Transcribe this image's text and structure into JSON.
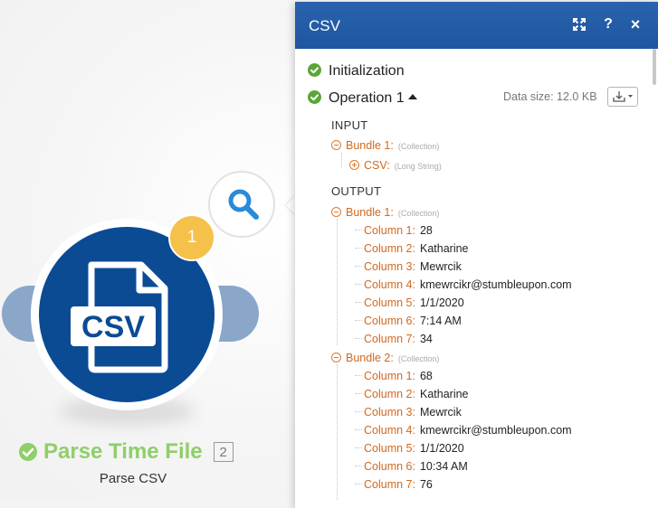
{
  "module": {
    "name": "Parse Time File",
    "id": "2",
    "subtitle": "Parse CSV",
    "operations_count": "1",
    "icon_text": "CSV",
    "colors": {
      "module": "#0b4b94",
      "ears": "#8aa6c9",
      "badge": "#f6c14a",
      "title": "#8fcf6a"
    }
  },
  "panel": {
    "title": "CSV",
    "expand_icon": "expand-icon",
    "help_label": "?",
    "close_label": "×",
    "initialization": "Initialization",
    "operation": "Operation 1",
    "data_size": "Data size: 12.0 KB",
    "input": {
      "heading": "INPUT",
      "bundle": {
        "key": "Bundle 1:",
        "type": "(Collection)"
      },
      "field": {
        "key": "CSV:",
        "type": "(Long String)"
      }
    },
    "output": {
      "heading": "OUTPUT",
      "bundles": [
        {
          "key": "Bundle 1:",
          "type": "(Collection)",
          "columns": [
            {
              "key": "Column 1:",
              "value": "28"
            },
            {
              "key": "Column 2:",
              "value": "Katharine"
            },
            {
              "key": "Column 3:",
              "value": "Mewrcik"
            },
            {
              "key": "Column 4:",
              "value": "kmewrcikr@stumbleupon.com"
            },
            {
              "key": "Column 5:",
              "value": "1/1/2020"
            },
            {
              "key": "Column 6:",
              "value": "7:14 AM"
            },
            {
              "key": "Column 7:",
              "value": "34"
            }
          ]
        },
        {
          "key": "Bundle 2:",
          "type": "(Collection)",
          "columns": [
            {
              "key": "Column 1:",
              "value": "68"
            },
            {
              "key": "Column 2:",
              "value": "Katharine"
            },
            {
              "key": "Column 3:",
              "value": "Mewrcik"
            },
            {
              "key": "Column 4:",
              "value": "kmewrcikr@stumbleupon.com"
            },
            {
              "key": "Column 5:",
              "value": "1/1/2020"
            },
            {
              "key": "Column 6:",
              "value": "10:34 AM"
            },
            {
              "key": "Column 7:",
              "value": "76"
            }
          ]
        }
      ]
    },
    "colors": {
      "header": "#1e56a0",
      "key": "#d2691e",
      "success": "#5aa637"
    }
  }
}
